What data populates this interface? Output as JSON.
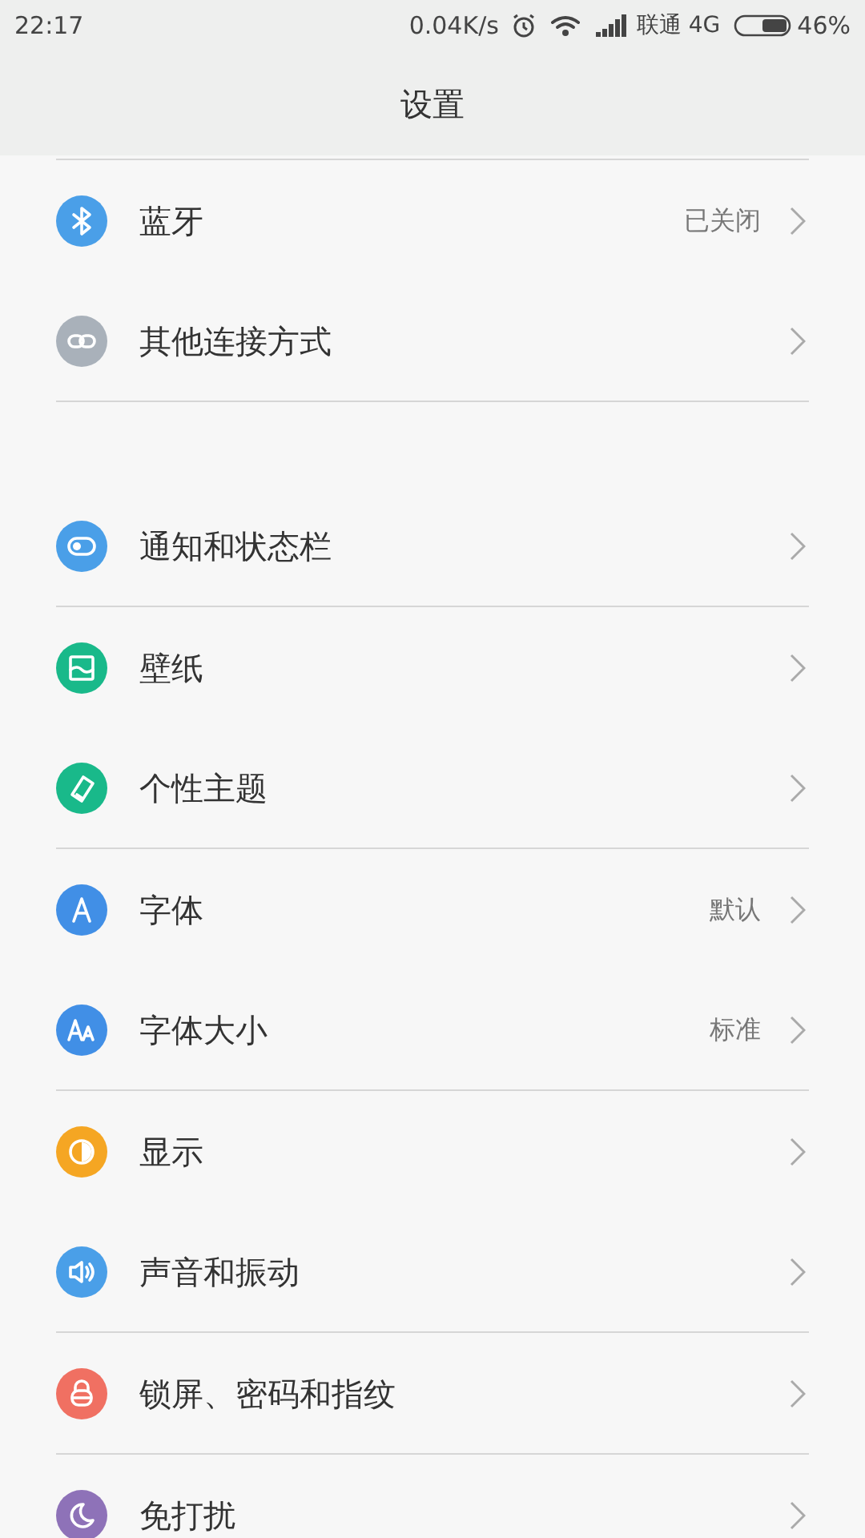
{
  "status_bar": {
    "time": "22:17",
    "speed": "0.04K/s",
    "carrier": "联通 4G",
    "battery": "46%"
  },
  "title": "设置",
  "groups": [
    {
      "items": [
        {
          "label": "蓝牙",
          "value": "已关闭",
          "color": "#4a9fe8"
        },
        {
          "label": "其他连接方式",
          "color": "#a9b1ba"
        }
      ]
    },
    {
      "items": [
        {
          "label": "通知和状态栏",
          "color": "#4a9fe8"
        }
      ]
    },
    {
      "items": [
        {
          "label": "壁纸",
          "color": "#19b98a"
        },
        {
          "label": "个性主题",
          "color": "#19b98a"
        }
      ]
    },
    {
      "items": [
        {
          "label": "字体",
          "value": "默认",
          "color": "#418fe6"
        },
        {
          "label": "字体大小",
          "value": "标准",
          "color": "#418fe6"
        }
      ]
    },
    {
      "items": [
        {
          "label": "显示",
          "color": "#f5a623"
        },
        {
          "label": "声音和振动",
          "color": "#4a9fe8"
        }
      ]
    },
    {
      "items": [
        {
          "label": "锁屏、密码和指纹",
          "color": "#f07062"
        }
      ]
    },
    {
      "items": [
        {
          "label": "免打扰",
          "color": "#8e72b8"
        }
      ]
    }
  ]
}
